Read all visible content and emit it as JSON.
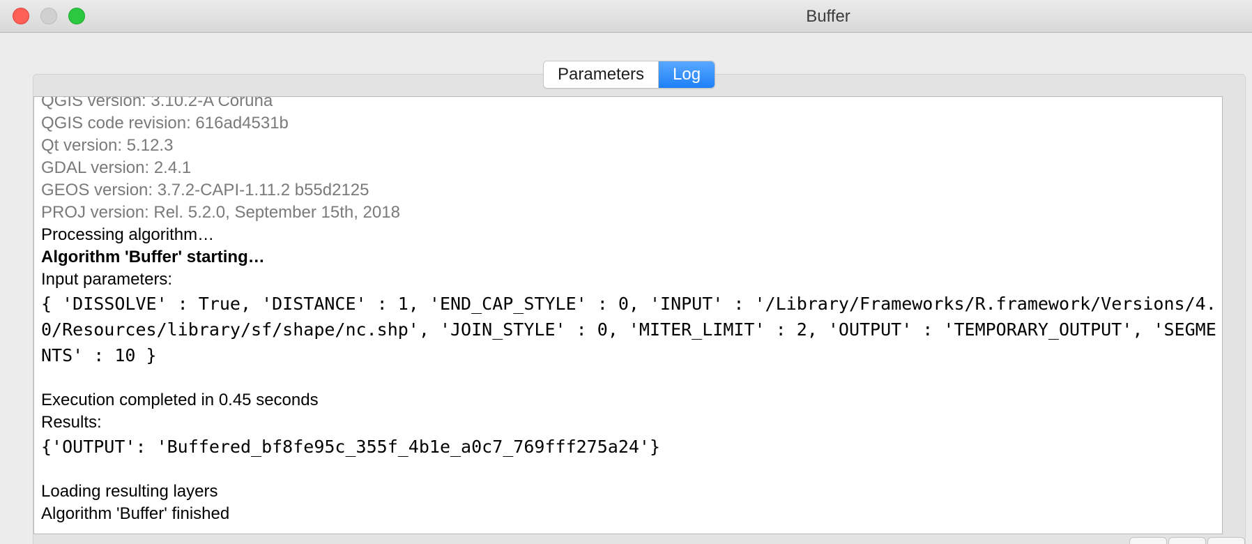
{
  "window": {
    "title": "Buffer"
  },
  "tabs": [
    {
      "label": "Parameters",
      "active": false
    },
    {
      "label": "Log",
      "active": true
    }
  ],
  "log": {
    "qgis_version": "QGIS version: 3.10.2-A Coruña",
    "qgis_code_revision": "QGIS code revision: 616ad4531b",
    "qt_version": "Qt version: 5.12.3",
    "gdal_version": "GDAL version: 2.4.1",
    "geos_version": "GEOS version: 3.7.2-CAPI-1.11.2 b55d2125",
    "proj_version": "PROJ version: Rel. 5.2.0, September 15th, 2018",
    "processing": "Processing algorithm…",
    "starting": "Algorithm 'Buffer' starting…",
    "input_parameters_label": "Input parameters:",
    "input_parameters": "{ 'DISSOLVE' : True, 'DISTANCE' : 1, 'END_CAP_STYLE' : 0, 'INPUT' : '/Library/Frameworks/R.framework/Versions/4.0/Resources/library/sf/shape/nc.shp', 'JOIN_STYLE' : 0, 'MITER_LIMIT' : 2, 'OUTPUT' : 'TEMPORARY_OUTPUT', 'SEGMENTS' : 10 }",
    "execution": "Execution completed in 0.45 seconds",
    "results_label": "Results:",
    "results": "{'OUTPUT': 'Buffered_bf8fe95c_355f_4b1e_a0c7_769fff275a24'}",
    "loading": "Loading resulting layers",
    "finished": "Algorithm 'Buffer' finished"
  },
  "colors": {
    "tab_active": "#1d80f7",
    "log_meta_text": "#7a7a7a"
  }
}
